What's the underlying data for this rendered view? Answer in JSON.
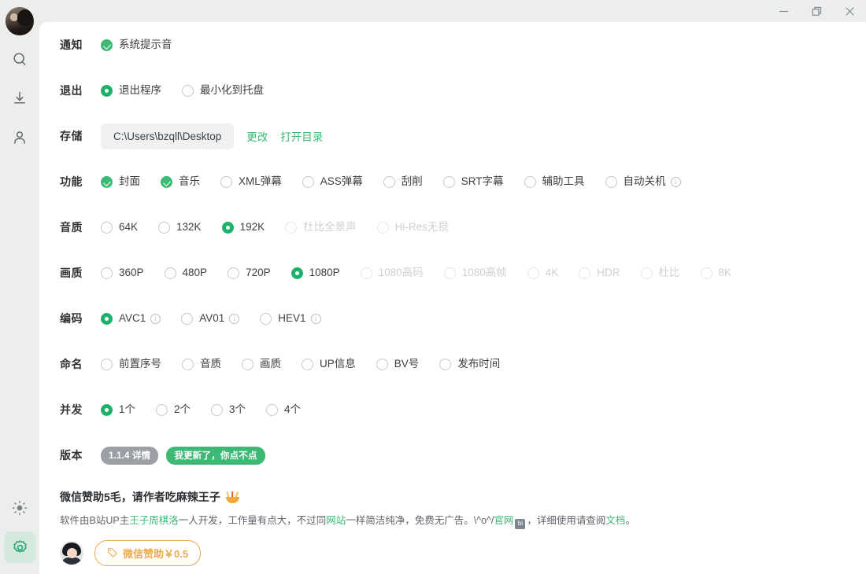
{
  "window": {
    "controls": [
      {
        "name": "minimize",
        "glyph": "minimize-icon"
      },
      {
        "name": "maximize",
        "glyph": "restore-icon"
      },
      {
        "name": "close",
        "glyph": "close-icon"
      }
    ]
  },
  "rail": {
    "avatar_name": "user-avatar",
    "items": [
      {
        "name": "search-icon",
        "active": false
      },
      {
        "name": "download-icon",
        "active": false
      },
      {
        "name": "user-icon",
        "active": false
      }
    ],
    "bottom_items": [
      {
        "name": "theme-icon",
        "active": false
      },
      {
        "name": "settings-icon",
        "active": true
      }
    ]
  },
  "colors": {
    "accent_green": "#3cba75",
    "radio_green": "#1db26a",
    "disabled_gray": "#ccd0d4",
    "orange": "#f0a94a",
    "pill_gray": "#9aa0a6"
  },
  "rows": [
    {
      "label": "通知",
      "key": "notification",
      "options": [
        {
          "text": "系统提示音",
          "state": "check-on",
          "disabled": false
        }
      ]
    },
    {
      "label": "退出",
      "key": "exit",
      "options": [
        {
          "text": "退出程序",
          "state": "radio-on",
          "disabled": false
        },
        {
          "text": "最小化到托盘",
          "state": "ring",
          "disabled": false
        }
      ]
    },
    {
      "label": "功能",
      "key": "features",
      "options": [
        {
          "text": "封面",
          "state": "check-on",
          "disabled": false
        },
        {
          "text": "音乐",
          "state": "check-on",
          "disabled": false
        },
        {
          "text": "XML弹幕",
          "state": "ring",
          "disabled": false
        },
        {
          "text": "ASS弹幕",
          "state": "ring",
          "disabled": false
        },
        {
          "text": "刮削",
          "state": "ring",
          "disabled": false
        },
        {
          "text": "SRT字幕",
          "state": "ring",
          "disabled": false
        },
        {
          "text": "辅助工具",
          "state": "ring",
          "disabled": false
        },
        {
          "text": "自动关机",
          "state": "ring",
          "disabled": false,
          "info": true
        }
      ]
    },
    {
      "label": "音质",
      "key": "audio_quality",
      "options": [
        {
          "text": "64K",
          "state": "ring",
          "disabled": false
        },
        {
          "text": "132K",
          "state": "ring",
          "disabled": false
        },
        {
          "text": "192K",
          "state": "radio-on",
          "disabled": false
        },
        {
          "text": "杜比全景声",
          "state": "ring",
          "disabled": true
        },
        {
          "text": "Hi-Res无损",
          "state": "ring",
          "disabled": true
        }
      ]
    },
    {
      "label": "画质",
      "key": "video_quality",
      "options": [
        {
          "text": "360P",
          "state": "ring",
          "disabled": false
        },
        {
          "text": "480P",
          "state": "ring",
          "disabled": false
        },
        {
          "text": "720P",
          "state": "ring",
          "disabled": false
        },
        {
          "text": "1080P",
          "state": "radio-on",
          "disabled": false
        },
        {
          "text": "1080高码",
          "state": "ring",
          "disabled": true
        },
        {
          "text": "1080高帧",
          "state": "ring",
          "disabled": true
        },
        {
          "text": "4K",
          "state": "ring",
          "disabled": true
        },
        {
          "text": "HDR",
          "state": "ring",
          "disabled": true
        },
        {
          "text": "杜比",
          "state": "ring",
          "disabled": true
        },
        {
          "text": "8K",
          "state": "ring",
          "disabled": true
        }
      ]
    },
    {
      "label": "编码",
      "key": "codec",
      "options": [
        {
          "text": "AVC1",
          "state": "radio-on",
          "disabled": false,
          "info": true
        },
        {
          "text": "AV01",
          "state": "ring",
          "disabled": false,
          "info": true
        },
        {
          "text": "HEV1",
          "state": "ring",
          "disabled": false,
          "info": true
        }
      ]
    },
    {
      "label": "命名",
      "key": "naming",
      "options": [
        {
          "text": "前置序号",
          "state": "ring",
          "disabled": false
        },
        {
          "text": "音质",
          "state": "ring",
          "disabled": false
        },
        {
          "text": "画质",
          "state": "ring",
          "disabled": false
        },
        {
          "text": "UP信息",
          "state": "ring",
          "disabled": false
        },
        {
          "text": "BV号",
          "state": "ring",
          "disabled": false
        },
        {
          "text": "发布时间",
          "state": "ring",
          "disabled": false
        }
      ]
    },
    {
      "label": "并发",
      "key": "concurrency",
      "options": [
        {
          "text": "1个",
          "state": "radio-on",
          "disabled": false
        },
        {
          "text": "2个",
          "state": "ring",
          "disabled": false
        },
        {
          "text": "3个",
          "state": "ring",
          "disabled": false
        },
        {
          "text": "4个",
          "state": "ring",
          "disabled": false
        }
      ]
    }
  ],
  "storage": {
    "label": "存储",
    "path": "C:\\Users\\bzqll\\Desktop",
    "change_label": "更改",
    "open_dir_label": "打开目录"
  },
  "version": {
    "label": "版本",
    "version_pill": "1.1.4 详情",
    "update_pill": "我更新了，你点不点"
  },
  "donate": {
    "title": "微信赞助5毛，请作者吃麻辣王子",
    "desc_1": "软件由B站UP主",
    "link_author": "王子周棋洛",
    "desc_2": "一人开发，工作量有点大，不过同",
    "link_site": "网站",
    "desc_3": "一样简洁纯净，免费无广告。\\^o^/",
    "link_official": "官网",
    "badge": "bi",
    "desc_4": "，详细使用请查阅",
    "link_docs": "文档",
    "desc_5": "。",
    "button_label": "微信赞助￥0.5"
  }
}
